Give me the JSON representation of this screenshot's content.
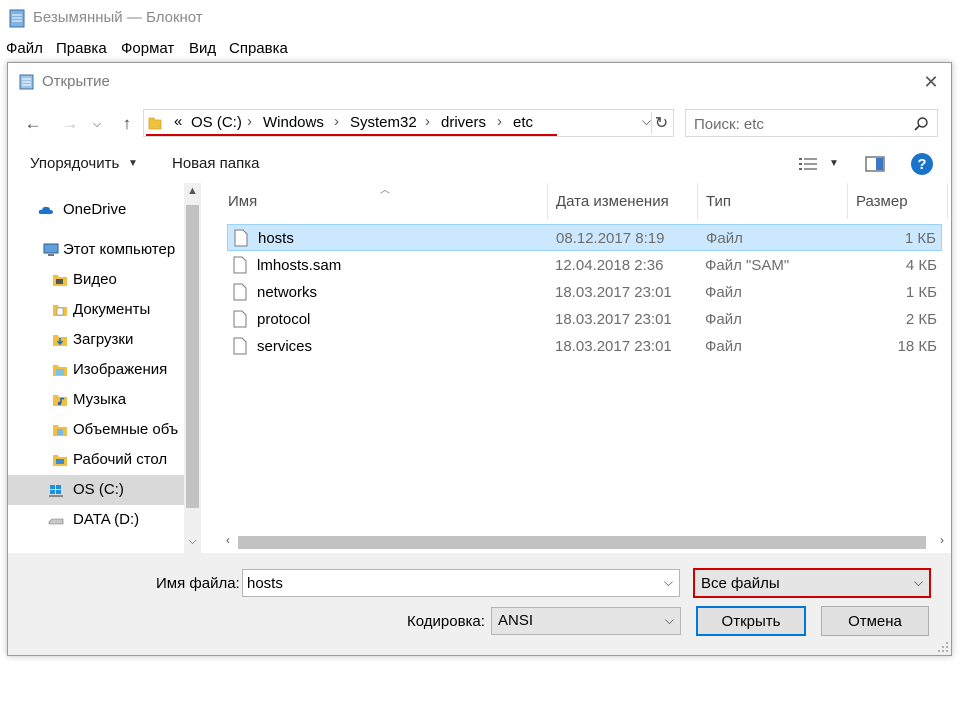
{
  "notepad": {
    "title": "Безымянный — Блокнот",
    "menu": [
      "Файл",
      "Правка",
      "Формат",
      "Вид",
      "Справка"
    ]
  },
  "dialog": {
    "title": "Открытие",
    "breadcrumb": {
      "overflow": "«",
      "parts": [
        "OS (C:)",
        "Windows",
        "System32",
        "drivers",
        "etc"
      ]
    },
    "search": {
      "placeholder": "Поиск: etc"
    },
    "toolbar": {
      "organize": "Упорядочить",
      "new_folder": "Новая папка"
    },
    "nav": [
      {
        "label": "OneDrive",
        "icon": "cloud-icon"
      },
      {
        "label": "Этот компьютер",
        "icon": "computer-icon"
      },
      {
        "label": "Видео",
        "icon": "video-folder-icon"
      },
      {
        "label": "Документы",
        "icon": "documents-folder-icon"
      },
      {
        "label": "Загрузки",
        "icon": "downloads-folder-icon"
      },
      {
        "label": "Изображения",
        "icon": "pictures-folder-icon"
      },
      {
        "label": "Музыка",
        "icon": "music-folder-icon"
      },
      {
        "label": "Объемные объ",
        "icon": "3d-objects-folder-icon"
      },
      {
        "label": "Рабочий стол",
        "icon": "desktop-folder-icon"
      },
      {
        "label": "OS (C:)",
        "icon": "windows-drive-icon",
        "selected": true
      },
      {
        "label": "DATA (D:)",
        "icon": "drive-icon"
      }
    ],
    "columns": {
      "name": "Имя",
      "date": "Дата изменения",
      "type": "Тип",
      "size": "Размер"
    },
    "files": [
      {
        "name": "hosts",
        "date": "08.12.2017 8:19",
        "type": "Файл",
        "size": "1 КБ",
        "selected": true
      },
      {
        "name": "lmhosts.sam",
        "date": "12.04.2018 2:36",
        "type": "Файл \"SAM\"",
        "size": "4 КБ"
      },
      {
        "name": "networks",
        "date": "18.03.2017 23:01",
        "type": "Файл",
        "size": "1 КБ"
      },
      {
        "name": "protocol",
        "date": "18.03.2017 23:01",
        "type": "Файл",
        "size": "2 КБ"
      },
      {
        "name": "services",
        "date": "18.03.2017 23:01",
        "type": "Файл",
        "size": "18 КБ"
      }
    ],
    "filename_label": "Имя файла:",
    "filename_value": "hosts",
    "filetype_value": "Все файлы",
    "encoding_label": "Кодировка:",
    "encoding_value": "ANSI",
    "open_button": "Открыть",
    "cancel_button": "Отмена"
  },
  "colors": {
    "accent": "#0078d7",
    "highlight": "#d00000",
    "selection": "#cce8ff",
    "folder": "#f0c040"
  }
}
